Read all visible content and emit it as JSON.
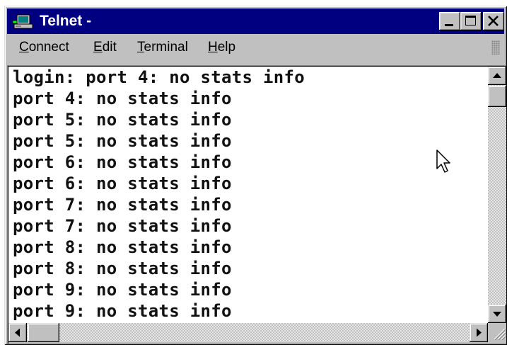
{
  "window": {
    "title": "Telnet -",
    "icons": {
      "app": "telnet-computer-icon",
      "minimize": "minimize-icon",
      "maximize": "maximize-icon",
      "close": "close-icon"
    }
  },
  "menu": [
    {
      "accel": "C",
      "rest": "onnect"
    },
    {
      "accel": "E",
      "rest": "dit"
    },
    {
      "accel": "T",
      "rest": "erminal"
    },
    {
      "accel": "H",
      "rest": "elp"
    }
  ],
  "terminal": {
    "lines": [
      "login: port 4: no stats info",
      "port 4: no stats info",
      "port 5: no stats info",
      "port 5: no stats info",
      "port 6: no stats info",
      "port 6: no stats info",
      "port 7: no stats info",
      "port 7: no stats info",
      "port 8: no stats info",
      "port 8: no stats info",
      "port 9: no stats info",
      "port 9: no stats info"
    ]
  },
  "scrollbar": {
    "vertical_position": 0,
    "horizontal_position": 0
  },
  "icons": {
    "up_arrow": "arrow-up-icon",
    "down_arrow": "arrow-down-icon",
    "left_arrow": "arrow-left-icon",
    "right_arrow": "arrow-right-icon",
    "cursor": "mouse-pointer-icon",
    "size_grip": "size-grip-icon"
  },
  "colors": {
    "titlebar": "#000080",
    "face": "#c0c0c0",
    "terminal_bg": "#ffffff",
    "terminal_text": "#111111"
  }
}
